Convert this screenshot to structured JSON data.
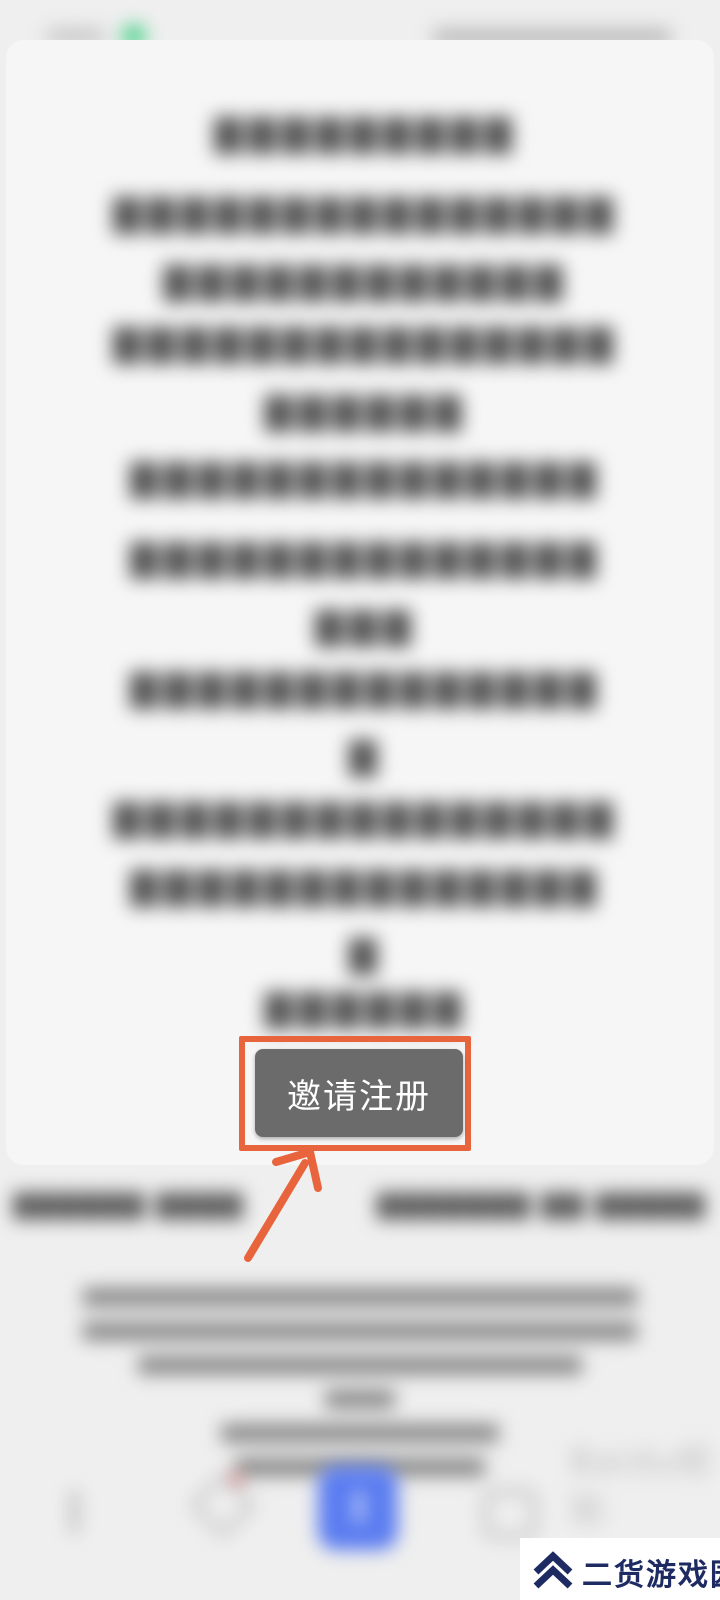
{
  "invite_button": {
    "label": "邀请注册"
  },
  "watermark": {
    "site_name": "二货游戏园",
    "baidu_label": "Baidu经验"
  },
  "colors": {
    "highlight_border": "#e8643c",
    "arrow": "#e8643c",
    "button_bg": "#6b6b6b",
    "nav_main": "#5a7cf0",
    "watermark_text": "#1e2b63"
  },
  "icons": {
    "arrow": "annotation-arrow-icon",
    "back": "back-icon",
    "pen": "pen-icon",
    "main": "publish-icon",
    "user": "user-icon",
    "site_logo": "chevron-up-logo-icon"
  }
}
